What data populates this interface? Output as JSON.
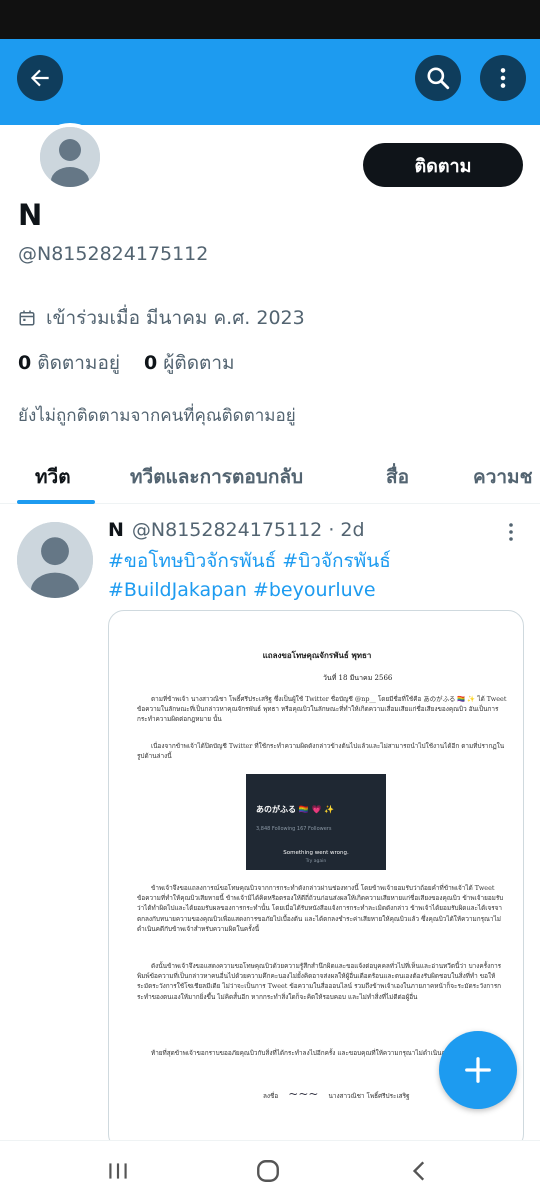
{
  "profile": {
    "display_name": "N",
    "handle": "@N8152824175112",
    "follow_button": "ติดตาม",
    "joined": "เข้าร่วมเมื่อ มีนาคม ค.ศ. 2023",
    "following_count": "0",
    "following_label": "ติดตามอยู่",
    "followers_count": "0",
    "followers_label": "ผู้ติดตาม",
    "not_followed_note": "ยังไม่ถูกติดตามจากคนที่คุณติดตามอยู่"
  },
  "tabs": [
    {
      "label": "ทวีต"
    },
    {
      "label": "ทวีตและการตอบกลับ"
    },
    {
      "label": "สื่อ"
    },
    {
      "label": "ความช"
    }
  ],
  "tweet": {
    "name": "N",
    "handle": "@N8152824175112",
    "separator": "·",
    "time": "2d",
    "hashtags": [
      "#ขอโทษบิวจักรพันธ์",
      "#บิวจักรพันธ์",
      "#BuildJakapan",
      "#beyourluve"
    ],
    "document": {
      "title": "แถลงขอโทษคุณจักรพันธ์ พุทธา",
      "date": "วันที่ 18 มีนาคม 2566",
      "para1": "ตามที่ข้าพเจ้า นางสาวณิชา โพธิ์ศรีประเสริฐ ซึ่งเป็นผู้ใช้ Twitter ชื่อบัญชี @np__ โดยมีชื่อที่ใช้คือ あのがふる 🏳️‍🌈 ✨ ได้ Tweet ข้อความในลักษณะที่เป็นกล่าวหาคุณจักรพันธ์ พุทธา หรือคุณบิวในลักษณะที่ทำให้เกิดความเสื่อมเสียแก่ชื่อเสียงของคุณบิว อันเป็นการกระทำความผิดต่อกฎหมาย นั้น",
      "para2": "เนื่องจากข้าพเจ้าได้ปิดบัญชี Twitter ที่ใช้กระทำความผิดดังกล่าวข้างต้นไปแล้วและไม่สามารถนำไปใช้งานได้อีก ตามที่ปรากฏในรูปด้านล่างนี้",
      "screenshot_name": "あのがふる 🏳️‍🌈 💗 ✨",
      "screenshot_stats": "3,848 Following   167 Followers",
      "screenshot_error": "Something went wrong.",
      "screenshot_retry": "Try again",
      "para3": "ข้าพเจ้าจึงขอแถลงการณ์ขอโทษคุณบิวจากการกระทำดังกล่าวผ่านช่องทางนี้ โดยข้าพเจ้ายอมรับว่าถ้อยคำที่ข้าพเจ้าได้ Tweet ข้อความที่ทำให้คุณบิวเสียหายนี้ ข้าพเจ้ามิได้คิดหรือตรองให้ดีถี่ถ้วนก่อนส่งผลให้เกิดความเสียหายแก่ชื่อเสียงของคุณบิว ข้าพเจ้ายอมรับว่าได้ทำผิดไปและได้ยอมรับผลของการกระทำนั้น โดยเมื่อได้รับหนังสือแจ้งการกระทำละเมิดดังกล่าว ข้าพเจ้าได้ยอมรับผิดและได้เจรจาตกลงกับทนายความของคุณบิวเพื่อแสดงการขอภัยไปเบื้องต้น และได้ตกลงชำระค่าเสียหายให้คุณบิวแล้ว ซึ่งคุณบิวได้ให้ความกรุณาไม่ดำเนินคดีกับข้าพเจ้าสำหรับความผิดในครั้งนี้",
      "para4": "ดังนั้นข้าพเจ้าจึงขอแสดงความขอโทษคุณบิวด้วยความรู้สึกสำนึกผิดและขอแจ้งต่อบุคคลทั่วไปที่เห็นและอ่านทวีตนี้ว่า บางครั้งการพิมพ์ข้อความที่เป็นกล่าวหาคนอื่นไปด้วยความคึกคะนองไม่ยั้งคิดอาจส่งผลให้ผู้อื่นเดือดร้อนและตนเองต้องรับผิดชอบในสิ่งที่ทำ ขอให้ระมัดระวังการใช้โซเชียลมีเดีย ไม่ว่าจะเป็นการ Tweet ข้อความในสื่อออนไลน์ รวมถึงข้าพเจ้าเองในภายภาคหน้าก็จะระมัดระวังการกระทำของตนเองให้มากยิ่งขึ้น ไม่คิดสั้นอีก หากกระทำสิ่งใดก็จะคิดให้รอบคอบ และไม่ทำสิ่งที่ไม่ดีต่อผู้อื่น",
      "para5": "ท้ายที่สุดข้าพเจ้าขอกราบขออภัยคุณบิวกับสิ่งที่ได้กระทำลงไปอีกครั้ง และขอบคุณที่ให้ความกรุณาไม่ดำเนินคดีกับข้าพเจ้า",
      "sign_label": "ลงชื่อ",
      "signer": "นางสาวณิชา โพธิ์ศรีประเสริฐ"
    }
  },
  "icons": {
    "back": "arrow-left-icon",
    "search": "search-icon",
    "more": "more-vertical-icon",
    "calendar": "calendar-icon",
    "compose": "plus-icon",
    "nav_recent": "recent-apps-icon",
    "nav_home": "home-circle-icon",
    "nav_back": "chevron-left-icon"
  },
  "colors": {
    "accent": "#1d9bf0",
    "header_button": "#0f3d5c",
    "text_primary": "#0f1419",
    "text_secondary": "#536471"
  }
}
